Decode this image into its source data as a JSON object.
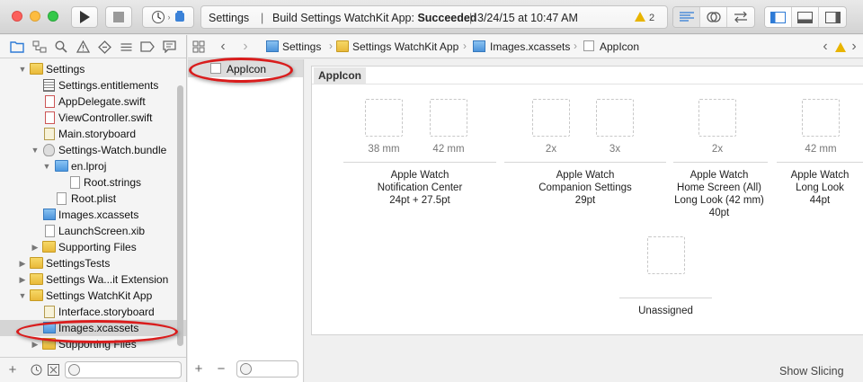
{
  "toolbar": {
    "activity": {
      "project": "Settings",
      "separator": "|",
      "status_prefix": "Build Settings WatchKit App: ",
      "status_result": "Succeeded",
      "timestamp": "3/24/15 at 10:47 AM",
      "warning_count": "2"
    }
  },
  "navigator": {
    "tree": [
      {
        "label": "Settings",
        "icon": "folder-yellow",
        "depth": 0,
        "expanded": true
      },
      {
        "label": "Settings.entitlements",
        "icon": "entitlements-file",
        "depth": 1
      },
      {
        "label": "AppDelegate.swift",
        "icon": "swift-file",
        "depth": 1
      },
      {
        "label": "ViewController.swift",
        "icon": "swift-file",
        "depth": 1
      },
      {
        "label": "Main.storyboard",
        "icon": "storyboard-file",
        "depth": 1
      },
      {
        "label": "Settings-Watch.bundle",
        "icon": "bundle",
        "depth": 1,
        "expanded": true
      },
      {
        "label": "en.lproj",
        "icon": "folder-blue",
        "depth": 2,
        "expanded": true
      },
      {
        "label": "Root.strings",
        "icon": "plain-file",
        "depth": 3
      },
      {
        "label": "Root.plist",
        "icon": "plain-file",
        "depth": 2
      },
      {
        "label": "Images.xcassets",
        "icon": "asset-catalog",
        "depth": 1
      },
      {
        "label": "LaunchScreen.xib",
        "icon": "xib-file",
        "depth": 1
      },
      {
        "label": "Supporting Files",
        "icon": "folder-yellow",
        "depth": 1,
        "expanded": false
      },
      {
        "label": "SettingsTests",
        "icon": "folder-yellow",
        "depth": 0,
        "expanded": false
      },
      {
        "label": "Settings Wa...it Extension",
        "icon": "folder-yellow",
        "depth": 0,
        "expanded": false
      },
      {
        "label": "Settings WatchKit App",
        "icon": "folder-yellow",
        "depth": 0,
        "expanded": true
      },
      {
        "label": "Interface.storyboard",
        "icon": "storyboard-file",
        "depth": 1
      },
      {
        "label": "Images.xcassets",
        "icon": "asset-catalog",
        "depth": 1,
        "selected": true
      },
      {
        "label": "Supporting Files",
        "icon": "folder-yellow",
        "depth": 1,
        "expanded": false
      }
    ]
  },
  "jumpbar": {
    "crumbs": [
      "Settings",
      "Settings WatchKit App",
      "Images.xcassets",
      "AppIcon"
    ]
  },
  "asset_list": {
    "items": [
      {
        "label": "AppIcon",
        "selected": true
      }
    ]
  },
  "canvas": {
    "set_title": "AppIcon",
    "slots": [
      {
        "label": "38 mm"
      },
      {
        "label": "42 mm"
      },
      {
        "label": "2x"
      },
      {
        "label": "3x"
      },
      {
        "label": "2x"
      },
      {
        "label": "42 mm"
      }
    ],
    "groups": [
      {
        "lines": [
          "Apple Watch",
          "Notification Center",
          "24pt + 27.5pt"
        ]
      },
      {
        "lines": [
          "Apple Watch",
          "Companion Settings",
          "29pt"
        ]
      },
      {
        "lines": [
          "Apple Watch",
          "Home Screen (All)",
          "Long Look (42 mm)",
          "40pt"
        ]
      },
      {
        "lines": [
          "Apple Watch",
          "Long Look",
          "44pt"
        ]
      }
    ],
    "unassigned_label": "Unassigned",
    "show_slicing_label": "Show Slicing"
  },
  "colors": {
    "accent_blue": "#2e7bd6",
    "highlight_red": "#d91c1c",
    "warning_yellow": "#e8b400"
  }
}
